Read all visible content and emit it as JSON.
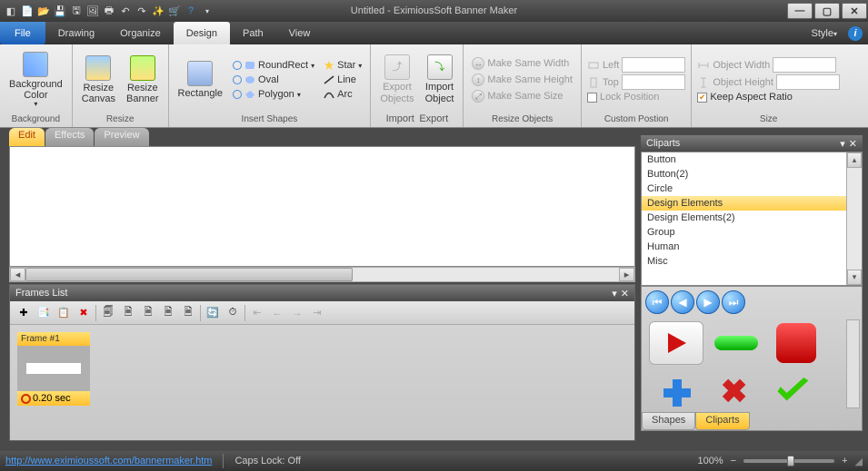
{
  "titlebar": {
    "title": "Untitled - EximiousSoft Banner Maker"
  },
  "menu": {
    "file": "File",
    "items": [
      "Drawing",
      "Organize",
      "Design",
      "Path",
      "View"
    ],
    "active": "Design",
    "style": "Style"
  },
  "ribbon": {
    "g_background": {
      "label": "Background",
      "bgcolor": "Background\nColor"
    },
    "g_resize": {
      "label": "Resize",
      "canvas": "Resize\nCanvas",
      "banner": "Resize\nBanner"
    },
    "g_insertshapes": {
      "label": "Insert Shapes",
      "rectangle": "Rectangle",
      "roundrect": "RoundRect",
      "oval": "Oval",
      "polygon": "Polygon",
      "star": "Star",
      "line": "Line",
      "arc": "Arc"
    },
    "g_import": {
      "label": "Import",
      "export_objects": "Export\nObjects",
      "import_object": "Import\nObject"
    },
    "g_export": {
      "label": "Export"
    },
    "g_resizeobj": {
      "label": "Resize Objects",
      "samewidth": "Make Same Width",
      "sameheight": "Make Same Height",
      "samesize": "Make Same Size"
    },
    "g_custompos": {
      "label": "Custom Postion",
      "left": "Left",
      "top": "Top",
      "lock": "Lock Position"
    },
    "g_size": {
      "label": "Size",
      "objw": "Object  Width",
      "objh": "Object Height",
      "keep": "Keep Aspect Ratio"
    }
  },
  "worktabs": {
    "edit": "Edit",
    "effects": "Effects",
    "preview": "Preview"
  },
  "frames": {
    "title": "Frames List",
    "frame1": {
      "label": "Frame #1",
      "time": "0.20 sec"
    }
  },
  "cliparts": {
    "title": "Cliparts",
    "items": [
      "Button",
      "Button(2)",
      "Circle",
      "Design Elements",
      "Design Elements(2)",
      "Group",
      "Human",
      "Misc"
    ],
    "selected": "Design Elements",
    "tabs": {
      "shapes": "Shapes",
      "cliparts": "Cliparts"
    }
  },
  "status": {
    "url": "http://www.eximioussoft.com/bannermaker.htm",
    "caps": "Caps Lock: Off",
    "zoom": "100%"
  }
}
